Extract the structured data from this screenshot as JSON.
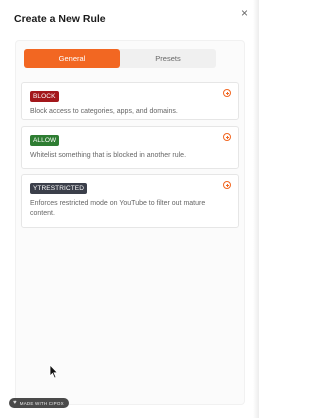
{
  "dialog": {
    "title": "Create a New Rule",
    "close_label": "×"
  },
  "tabs": [
    {
      "label": "General",
      "active": true
    },
    {
      "label": "Presets",
      "active": false
    }
  ],
  "rules": [
    {
      "badge": "BLOCK",
      "description": "Block access to categories, apps, and domains."
    },
    {
      "badge": "ALLOW",
      "description": "Whitelist something that is blocked in another rule."
    },
    {
      "badge": "YTRESTRICTED",
      "description": "Enforces restricted mode on YouTube to filter out mature content."
    }
  ],
  "footer": {
    "made_with": "MADE WITH CIPOX"
  },
  "colors": {
    "accent": "#f26722",
    "block": "#a3171b",
    "allow": "#2e7d32",
    "ytrestricted": "#3b3f4a"
  },
  "icons": {
    "close": "close-icon",
    "add": "plus-circle-icon",
    "cursor": "mouse-pointer-icon",
    "made_with": "heart-icon"
  }
}
